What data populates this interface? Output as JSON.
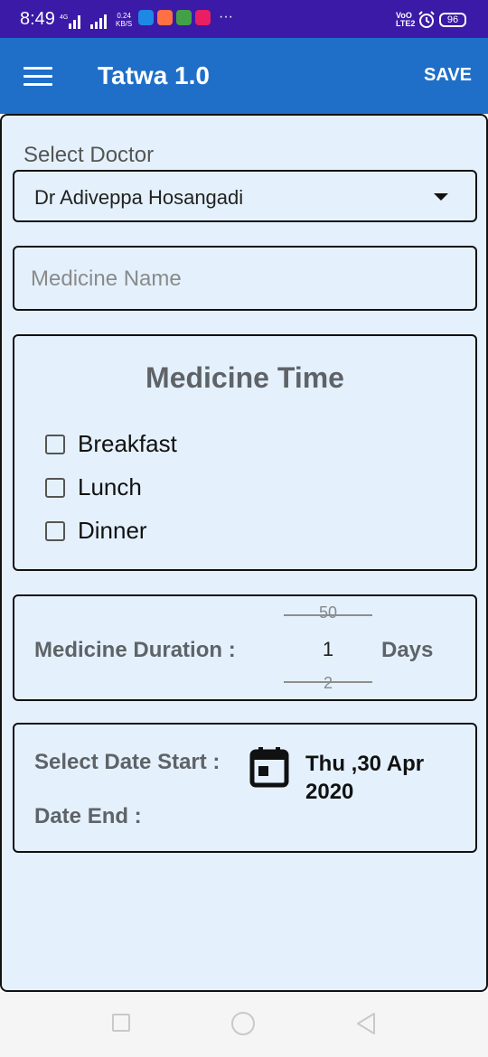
{
  "status_bar": {
    "time": "8:49",
    "network_type": "4G",
    "data_speed_value": "0.24",
    "data_speed_unit": "KB/S",
    "more_indicator": "···",
    "volte_top": "VoO",
    "volte_bottom": "LTE2",
    "battery": "96",
    "app_icon_colors": [
      "#1e88e5",
      "#ff7043",
      "#43a047",
      "#e91e63"
    ]
  },
  "app_bar": {
    "title": "Tatwa 1.0",
    "save_label": "SAVE",
    "color": "#1f6fc9"
  },
  "form": {
    "doctor_label": "Select Doctor",
    "doctor_selected": "Dr Adiveppa Hosangadi",
    "medicine_name_placeholder": "Medicine Name",
    "medicine_name_value": "",
    "medicine_time_title": "Medicine Time",
    "time_options": [
      {
        "label": "Breakfast",
        "checked": false
      },
      {
        "label": "Lunch",
        "checked": false
      },
      {
        "label": "Dinner",
        "checked": false
      }
    ],
    "duration_label": "Medicine Duration :",
    "duration_prev": "50",
    "duration_current": "1",
    "duration_next": "2",
    "duration_unit": "Days",
    "date_start_label": "Select Date Start :",
    "date_end_label": "Date End :",
    "date_value_line1": "Thu ,30 Apr",
    "date_value_line2": "2020"
  },
  "colors": {
    "status_bar": "#3a1aa6",
    "background": "#e4f1fd",
    "label_gray": "#5f6368"
  }
}
